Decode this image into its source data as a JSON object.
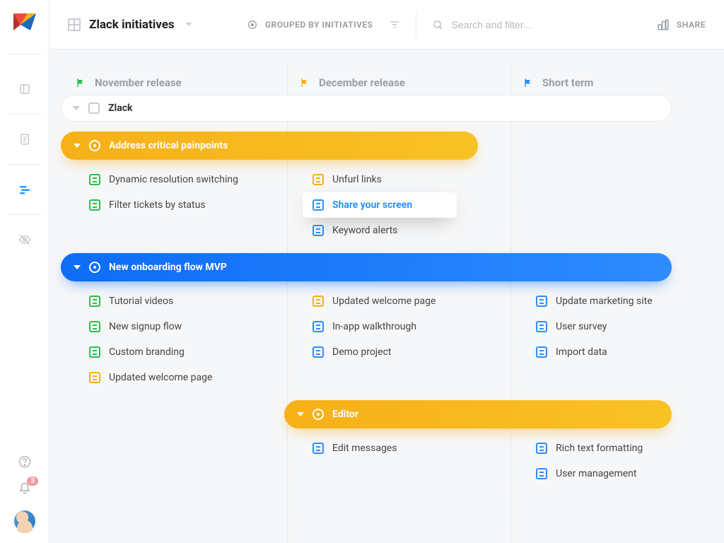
{
  "rail": {
    "notification_count": "3"
  },
  "topbar": {
    "title": "Zlack initiatives",
    "grouped_label": "GROUPED BY INITIATIVES",
    "search_placeholder": "Search and filter...",
    "share_label": "SHARE"
  },
  "columns": [
    {
      "label": "November release",
      "flag_color": "#2bbf4a"
    },
    {
      "label": "December release",
      "flag_color": "#f7b018"
    },
    {
      "label": "Short term",
      "flag_color": "#2e8cff"
    }
  ],
  "project": {
    "label": "Zlack"
  },
  "epics": [
    {
      "label": "Address critical painpoints",
      "style": "amber",
      "width": "w590",
      "tasks": [
        [
          {
            "label": "Dynamic resolution switching",
            "color": "green"
          },
          {
            "label": "Filter tickets by status",
            "color": "green"
          }
        ],
        [
          {
            "label": "Unfurl links",
            "color": "amber"
          },
          {
            "label": "Share your screen",
            "color": "blue",
            "highlight": true
          },
          {
            "label": "Keyword alerts",
            "color": "blue"
          }
        ],
        []
      ]
    },
    {
      "label": "New onboarding flow MVP",
      "style": "blue",
      "width": "w864",
      "tasks": [
        [
          {
            "label": "Tutorial videos",
            "color": "green"
          },
          {
            "label": "New signup flow",
            "color": "green"
          },
          {
            "label": "Custom branding",
            "color": "green"
          },
          {
            "label": "Updated welcome page",
            "color": "amber"
          }
        ],
        [
          {
            "label": "Updated welcome page",
            "color": "amber"
          },
          {
            "label": "In-app walkthrough",
            "color": "blue"
          },
          {
            "label": "Demo project",
            "color": "blue"
          }
        ],
        [
          {
            "label": "Update marketing site",
            "color": "blue"
          },
          {
            "label": "User survey",
            "color": "blue"
          },
          {
            "label": "Import data",
            "color": "blue"
          }
        ]
      ]
    },
    {
      "label": "Editor",
      "style": "amber",
      "width": "w548",
      "tasks": [
        [],
        [
          {
            "label": "Edit messages",
            "color": "blue"
          }
        ],
        [
          {
            "label": "Rich text formatting",
            "color": "blue"
          },
          {
            "label": "User management",
            "color": "blue"
          }
        ]
      ]
    }
  ]
}
